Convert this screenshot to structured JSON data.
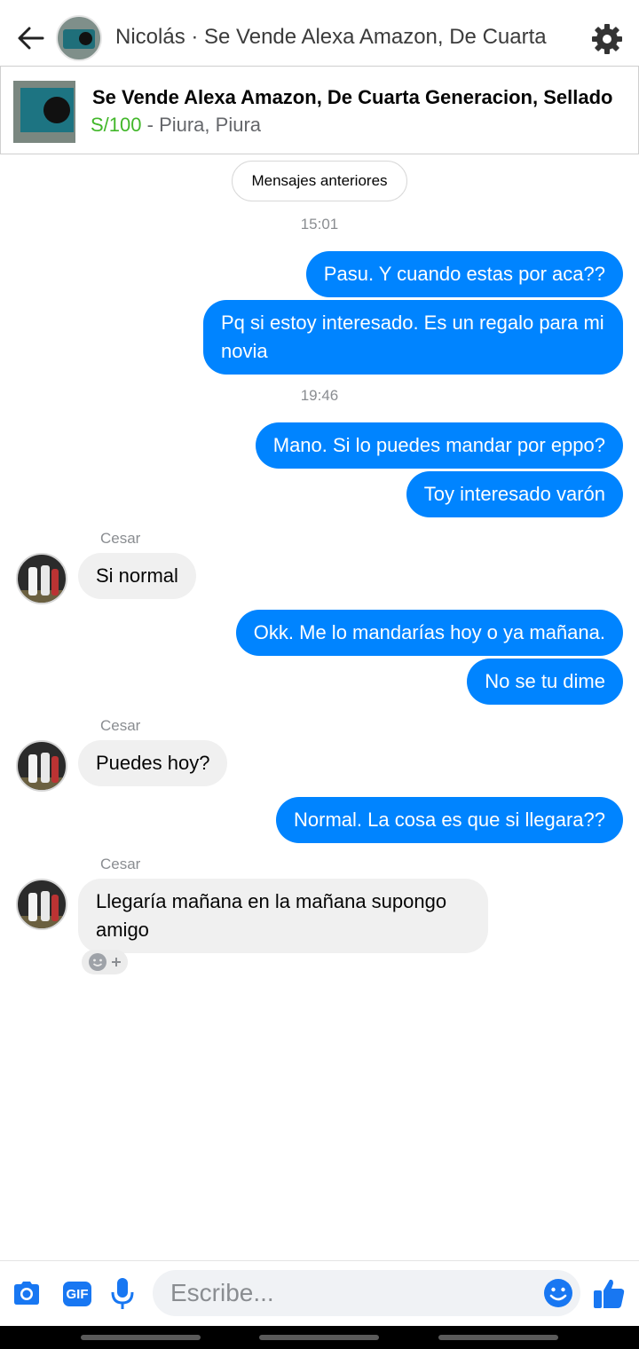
{
  "header": {
    "title": "Nicolás · Se Vende Alexa Amazon, De Cuarta"
  },
  "listing": {
    "title": "Se Vende Alexa Amazon, De Cuarta Generacion, Sellado",
    "price": "S/100",
    "separator": " - ",
    "location": "Piura, Piura"
  },
  "chat": {
    "older_messages_label": "Mensajes anteriores",
    "timestamps": [
      "15:01",
      "19:46"
    ],
    "messages": [
      {
        "dir": "out",
        "text": "Pasu. Y cuando estas por aca??"
      },
      {
        "dir": "out",
        "text": "Pq si estoy interesado. Es un regalo para mi novia"
      },
      {
        "dir": "out",
        "text": "Mano. Si lo puedes mandar por eppo?"
      },
      {
        "dir": "out",
        "text": "Toy interesado varón"
      },
      {
        "dir": "in",
        "sender": "Cesar",
        "text": "Si normal"
      },
      {
        "dir": "out",
        "text": "Okk. Me lo mandarías hoy o ya mañana."
      },
      {
        "dir": "out",
        "text": "No se tu dime"
      },
      {
        "dir": "in",
        "sender": "Cesar",
        "text": "Puedes hoy?"
      },
      {
        "dir": "out",
        "text": "Normal. La cosa es que si llegara??"
      },
      {
        "dir": "in",
        "sender": "Cesar",
        "text": "Llegaría mañana en la mañana supongo amigo"
      }
    ]
  },
  "composer": {
    "placeholder": "Escribe...",
    "gif_label": "GIF"
  },
  "icons": {
    "back": "arrow-left-icon",
    "settings": "gear-icon",
    "camera": "camera-icon",
    "gif": "gif-icon",
    "mic": "microphone-icon",
    "emoji": "smiley-icon",
    "like": "thumbs-up-icon",
    "react": "add-reaction-icon"
  },
  "colors": {
    "outgoing_bubble": "#0084ff",
    "incoming_bubble": "#f0f0f0",
    "price": "#42b72a",
    "accent": "#1877f2"
  }
}
